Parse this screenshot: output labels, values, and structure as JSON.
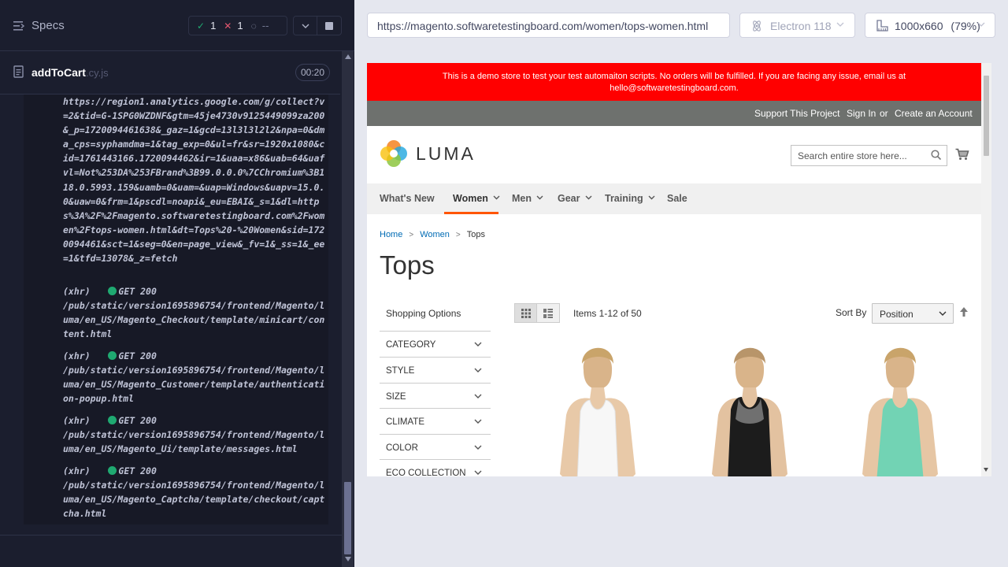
{
  "runner": {
    "specs_label": "Specs",
    "stats": {
      "passed": "1",
      "failed": "1",
      "pending": "--"
    },
    "spec": {
      "name": "addToCart",
      "ext": ".cy.js",
      "time": "00:20"
    },
    "log_url": "https://region1.analytics.google.com/g/collect?v=2&tid=G-1SPG0WZDNF&gtm=45je4730v9125449099za200&_p=1720094461638&_gaz=1&gcd=13l3l3l2l2&npa=0&dma_cps=syphamdma=1&tag_exp=0&ul=fr&sr=1920x1080&cid=1761443166.1720094462&ir=1&uaa=x86&uab=64&uafvl=Not%253DA%253FBrand%3B99.0.0.0%7CChromium%3B118.0.5993.159&uamb=0&uam=&uap=Windows&uapv=15.0.0&uaw=0&frm=1&pscdl=noapi&_eu=EBAI&_s=1&dl=https%3A%2F%2Fmagento.softwaretestingboard.com%2Fwomen%2Ftops-women.html&dt=Tops%20-%20Women&sid=1720094461&sct=1&seg=0&en=page_view&_fv=1&_ss=1&_ee=1&tfd=13078&_z=fetch",
    "requests": [
      {
        "tag": "(xhr)",
        "method": "GET 200",
        "path": "/pub/static/version1695896754/frontend/Magento/luma/en_US/Magento_Checkout/template/minicart/content.html"
      },
      {
        "tag": "(xhr)",
        "method": "GET 200",
        "path": "/pub/static/version1695896754/frontend/Magento/luma/en_US/Magento_Customer/template/authentication-popup.html"
      },
      {
        "tag": "(xhr)",
        "method": "GET 200",
        "path": "/pub/static/version1695896754/frontend/Magento/luma/en_US/Magento_Ui/template/messages.html"
      },
      {
        "tag": "(xhr)",
        "method": "GET 200",
        "path": "/pub/static/version1695896754/frontend/Magento/luma/en_US/Magento_Captcha/template/checkout/captcha.html"
      }
    ]
  },
  "browser": {
    "url": "https://magento.softwaretestingboard.com/women/tops-women.html",
    "browser_name": "Electron 118",
    "viewport": "1000x660",
    "zoom": "(79%)"
  },
  "site": {
    "demo_line1": "This is a demo store to test your test automaiton scripts. No orders will be fulfilled. If you are facing any issue, email us at",
    "demo_line2": "hello@softwaretestingboard.com.",
    "links": {
      "support": "Support This Project",
      "signin": "Sign In",
      "or": "or",
      "create": "Create an Account"
    },
    "logo": "LUMA",
    "search_placeholder": "Search entire store here...",
    "nav": [
      "What's New",
      "Women",
      "Men",
      "Gear",
      "Training",
      "Sale"
    ],
    "breadcrumb": [
      "Home",
      "Women",
      "Tops"
    ],
    "title": "Tops",
    "shopping_options": "Shopping Options",
    "filters": [
      "CATEGORY",
      "STYLE",
      "SIZE",
      "CLIMATE",
      "COLOR",
      "ECO COLLECTION"
    ],
    "items_count": "Items 1-12 of 50",
    "sort_label": "Sort By",
    "sort_value": "Position"
  },
  "colors": {
    "banner": "#ff0000",
    "nav_active": "#ff5501",
    "link": "#006bb4",
    "runner_bg": "#1b1e2e"
  }
}
